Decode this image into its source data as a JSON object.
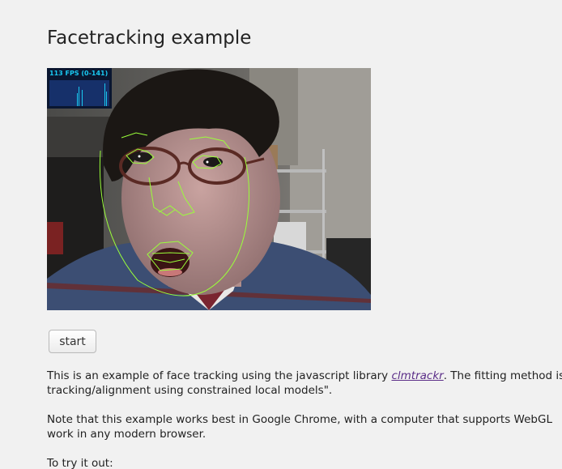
{
  "page": {
    "title": "Facetracking example"
  },
  "fps_meter": {
    "label": "113 FPS (0-141)",
    "color": "#19c8f0"
  },
  "video": {
    "description_icon": "webcam-feed-with-face-mesh"
  },
  "controls": {
    "start_label": "start"
  },
  "intro": {
    "line1_pre": "This is an example of face tracking using the javascript library ",
    "link_text": "clmtrackr",
    "line1_post": ". The fitting method is g",
    "line2": "tracking/alignment using constrained local models\"."
  },
  "note": {
    "line1": "Note that this example works best in Google Chrome, with a computer that supports WebGL",
    "line2": "work in any modern browser."
  },
  "try": {
    "label": "To try it out:"
  },
  "colors": {
    "background": "#f1f1f1",
    "mesh": "#9aff3a",
    "link": "#5b2d88"
  }
}
